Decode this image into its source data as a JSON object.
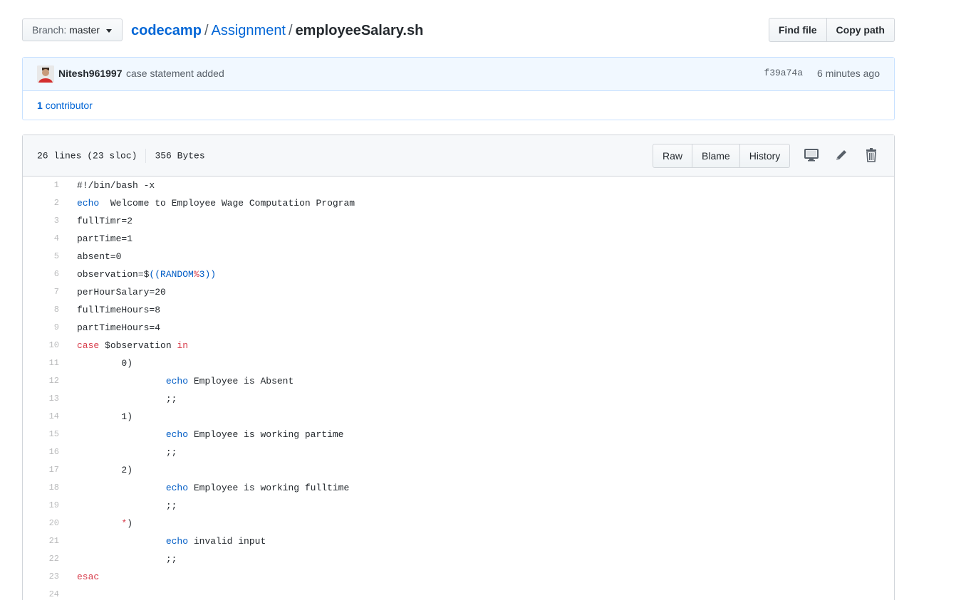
{
  "breadcrumb": {
    "branch_prefix": "Branch:",
    "branch_name": "master",
    "repo": "codecamp",
    "folder": "Assignment",
    "file": "employeeSalary.sh",
    "sep": "/"
  },
  "toolbar": {
    "find_file": "Find file",
    "copy_path": "Copy path"
  },
  "commit": {
    "author": "Nitesh961997",
    "message": "case statement added",
    "sha": "f39a74a",
    "time": "6 minutes ago",
    "contributor_count": "1",
    "contributor_label": "contributor"
  },
  "file": {
    "lines_info": "26 lines (23 sloc)",
    "size": "356 Bytes",
    "raw": "Raw",
    "blame": "Blame",
    "history": "History"
  },
  "colors": {
    "link": "#0366d6",
    "keyword": "#d73a49",
    "builtin": "#005cc5"
  },
  "icons": [
    "desktop-icon",
    "pencil-icon",
    "trashcan-icon"
  ],
  "code": [
    {
      "n": "1",
      "parts": [
        [
          "",
          "#!/bin/bash -x"
        ]
      ]
    },
    {
      "n": "2",
      "parts": [
        [
          "bl",
          "echo"
        ],
        [
          "",
          "  Welcome to Employee Wage Computation Program"
        ]
      ]
    },
    {
      "n": "3",
      "parts": [
        [
          "",
          "fullTimr=2"
        ]
      ]
    },
    {
      "n": "4",
      "parts": [
        [
          "",
          "partTime=1"
        ]
      ]
    },
    {
      "n": "5",
      "parts": [
        [
          "",
          "absent=0"
        ]
      ]
    },
    {
      "n": "6",
      "parts": [
        [
          "",
          "observation=$"
        ],
        [
          "bl",
          "((RANDOM"
        ],
        [
          "op",
          "%"
        ],
        [
          "bl",
          "3))"
        ]
      ]
    },
    {
      "n": "7",
      "parts": [
        [
          "",
          "perHourSalary=20"
        ]
      ]
    },
    {
      "n": "8",
      "parts": [
        [
          "",
          "fullTimeHours=8"
        ]
      ]
    },
    {
      "n": "9",
      "parts": [
        [
          "",
          "partTimeHours=4"
        ]
      ]
    },
    {
      "n": "10",
      "parts": [
        [
          "kw",
          "case"
        ],
        [
          "",
          " $observation "
        ],
        [
          "kw",
          "in"
        ]
      ]
    },
    {
      "n": "11",
      "parts": [
        [
          "",
          "        0)"
        ]
      ]
    },
    {
      "n": "12",
      "parts": [
        [
          "",
          "                "
        ],
        [
          "bl",
          "echo"
        ],
        [
          "",
          " Employee is Absent"
        ]
      ]
    },
    {
      "n": "13",
      "parts": [
        [
          "",
          "                ;;"
        ]
      ]
    },
    {
      "n": "14",
      "parts": [
        [
          "",
          "        1)"
        ]
      ]
    },
    {
      "n": "15",
      "parts": [
        [
          "",
          "                "
        ],
        [
          "bl",
          "echo"
        ],
        [
          "",
          " Employee is working partime"
        ]
      ]
    },
    {
      "n": "16",
      "parts": [
        [
          "",
          "                ;;"
        ]
      ]
    },
    {
      "n": "17",
      "parts": [
        [
          "",
          "        2)"
        ]
      ]
    },
    {
      "n": "18",
      "parts": [
        [
          "",
          "                "
        ],
        [
          "bl",
          "echo"
        ],
        [
          "",
          " Employee is working fulltime"
        ]
      ]
    },
    {
      "n": "19",
      "parts": [
        [
          "",
          "                ;;"
        ]
      ]
    },
    {
      "n": "20",
      "parts": [
        [
          "",
          "        "
        ],
        [
          "op",
          "*"
        ],
        [
          "",
          ")"
        ]
      ]
    },
    {
      "n": "21",
      "parts": [
        [
          "",
          "                "
        ],
        [
          "bl",
          "echo"
        ],
        [
          "",
          " invalid input"
        ]
      ]
    },
    {
      "n": "22",
      "parts": [
        [
          "",
          "                ;;"
        ]
      ]
    },
    {
      "n": "23",
      "parts": [
        [
          "kw",
          "esac"
        ]
      ]
    },
    {
      "n": "24",
      "parts": [
        [
          "",
          ""
        ]
      ]
    }
  ]
}
